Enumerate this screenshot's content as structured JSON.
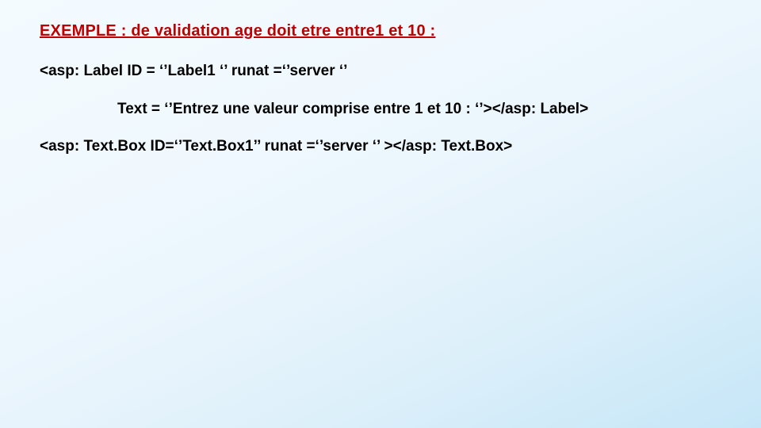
{
  "title": "EXEMPLE : de validation age doit etre entre1 et 10 :",
  "code": {
    "line1": "<asp: Label ID = ‘’Label1 ‘’ runat =‘’server ‘’",
    "line2": "Text = ‘’Entrez une valeur comprise entre 1 et 10 : ‘’></asp: Label>",
    "line3": "<asp: Text.Box ID=‘’Text.Box1’’ runat =‘’server ‘’ ></asp: Text.Box>"
  }
}
